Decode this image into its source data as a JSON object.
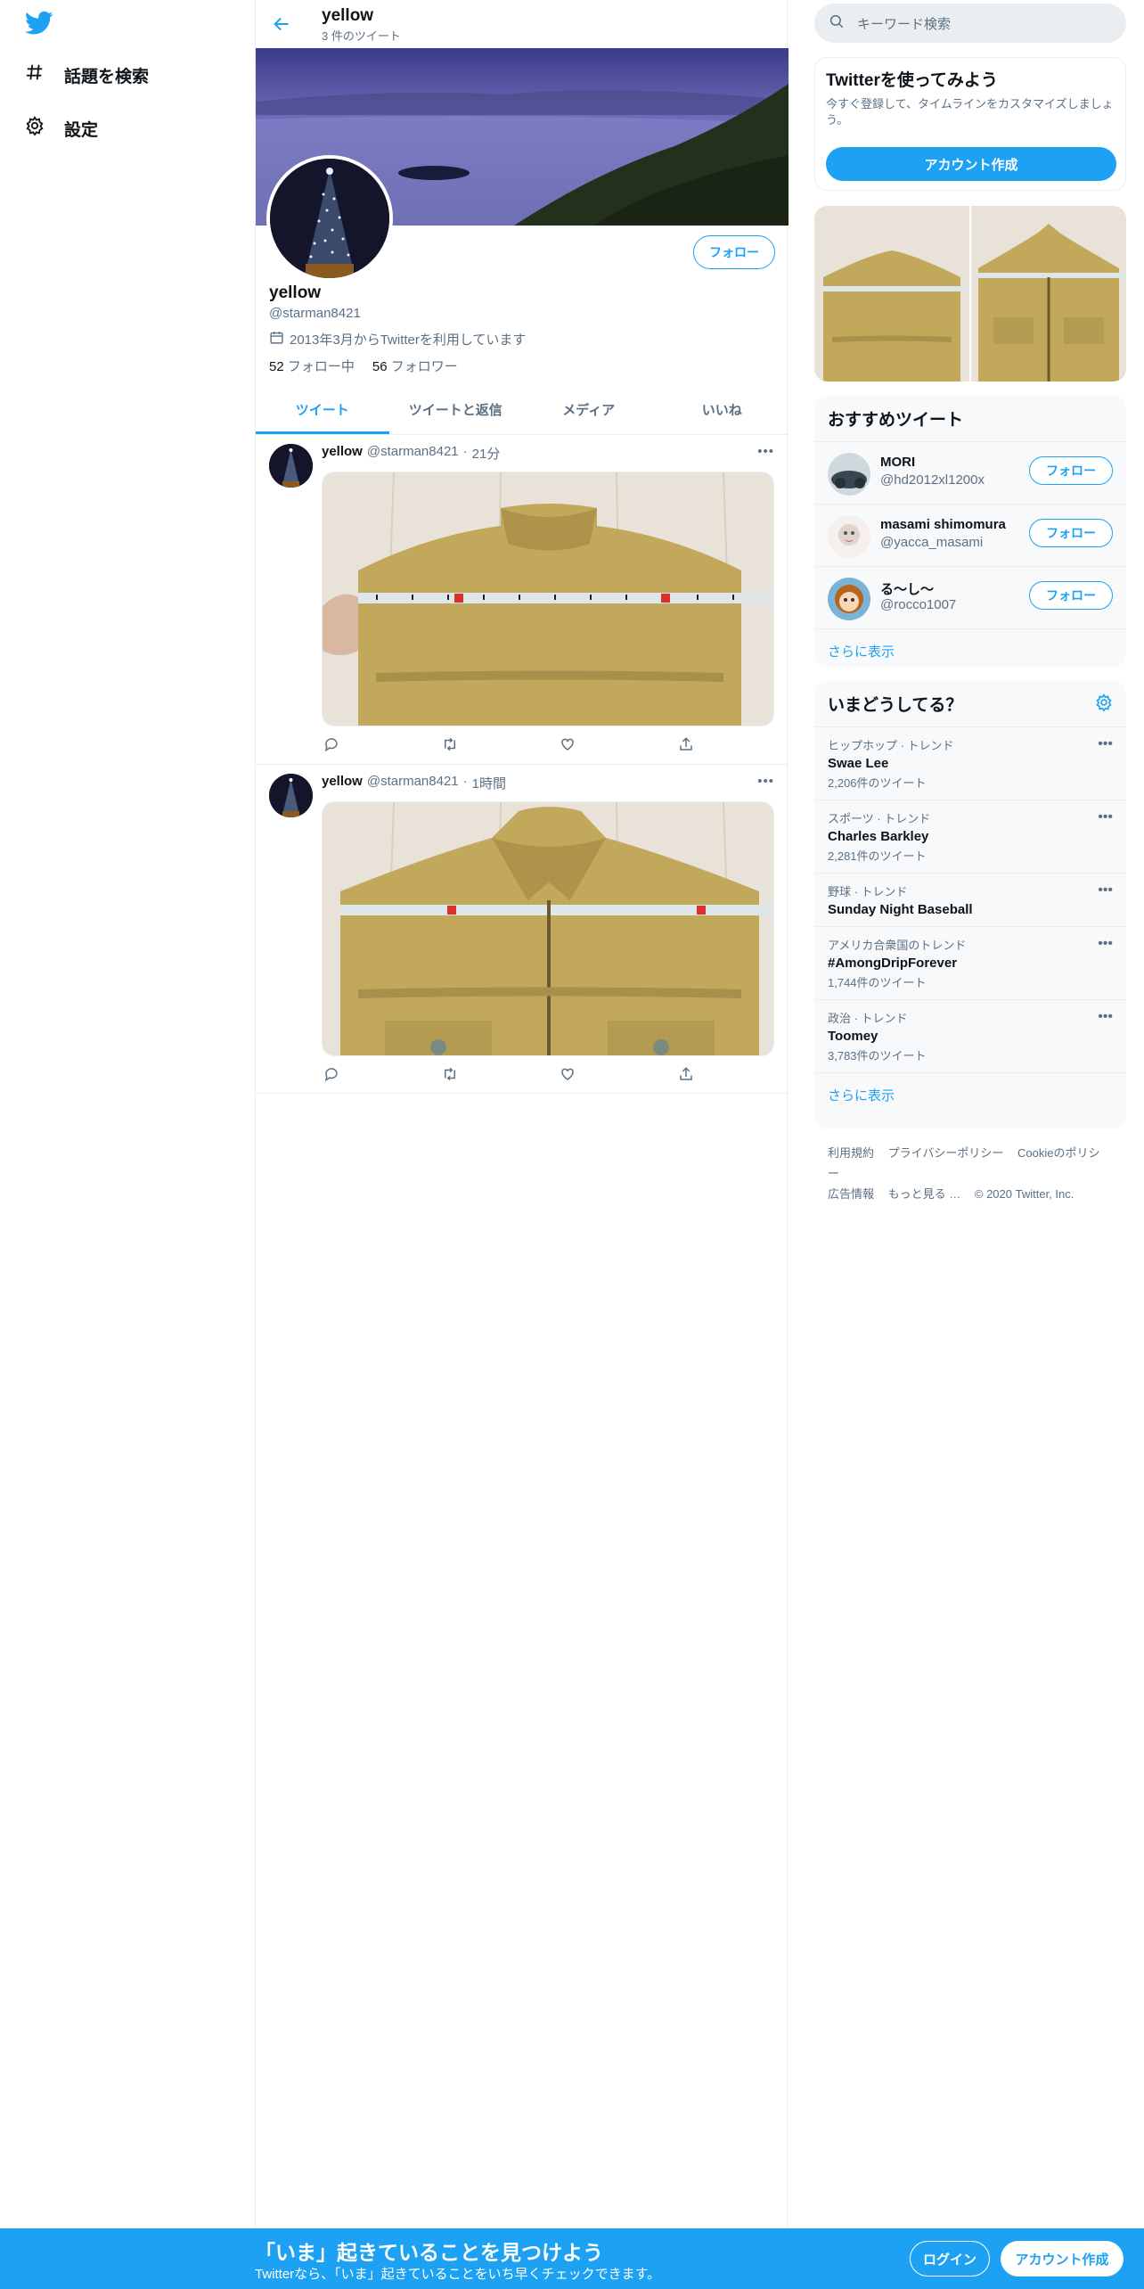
{
  "nav": {
    "explore": "話題を検索",
    "settings": "設定"
  },
  "header": {
    "title": "yellow",
    "subtitle": "3 件のツイート"
  },
  "profile": {
    "name": "yellow",
    "handle": "@starman8421",
    "joined": "2013年3月からTwitterを利用しています",
    "following_count": "52",
    "following_label": "フォロー中",
    "followers_count": "56",
    "followers_label": "フォロワー",
    "follow_button": "フォロー"
  },
  "tabs": [
    "ツイート",
    "ツイートと返信",
    "メディア",
    "いいね"
  ],
  "tweets": [
    {
      "name": "yellow",
      "handle": "@starman8421",
      "time": "21分"
    },
    {
      "name": "yellow",
      "handle": "@starman8421",
      "time": "1時間"
    }
  ],
  "search": {
    "placeholder": "キーワード検索"
  },
  "signup": {
    "title": "Twitterを使ってみよう",
    "subtitle": "今すぐ登録して、タイムラインをカスタマイズしましょう。",
    "button": "アカウント作成"
  },
  "recommend": {
    "title": "おすすめツイート",
    "users": [
      {
        "name": "MORI",
        "handle": "@hd2012xl1200x",
        "button": "フォロー"
      },
      {
        "name": "masami shimomura",
        "handle": "@yacca_masami",
        "button": "フォロー"
      },
      {
        "name": "る〜し〜",
        "handle": "@rocco1007",
        "button": "フォロー"
      }
    ],
    "more": "さらに表示"
  },
  "trends": {
    "title": "いまどうしてる？",
    "items": [
      {
        "meta": "ヒップホップ · トレンド",
        "name": "Swae Lee",
        "count": "2,206件のツイート"
      },
      {
        "meta": "スポーツ · トレンド",
        "name": "Charles Barkley",
        "count": "2,281件のツイート"
      },
      {
        "meta": "野球 · トレンド",
        "name": "Sunday Night Baseball",
        "count": ""
      },
      {
        "meta": "アメリカ合衆国のトレンド",
        "name": "#AmongDripForever",
        "count": "1,744件のツイート"
      },
      {
        "meta": "政治 · トレンド",
        "name": "Toomey",
        "count": "3,783件のツイート"
      }
    ],
    "more": "さらに表示"
  },
  "footer": {
    "links": [
      "利用規約",
      "プライバシーポリシー",
      "Cookieのポリシー",
      "広告情報",
      "もっと見る …"
    ],
    "copyright": "© 2020 Twitter, Inc."
  },
  "bottombar": {
    "title": "「いま」起きていることを見つけよう",
    "subtitle": "Twitterなら、「いま」起きていることをいち早くチェックできます。",
    "login": "ログイン",
    "signup": "アカウント作成"
  },
  "colors": {
    "accent": "#1da1f2",
    "secondary_text": "#5b7083"
  }
}
